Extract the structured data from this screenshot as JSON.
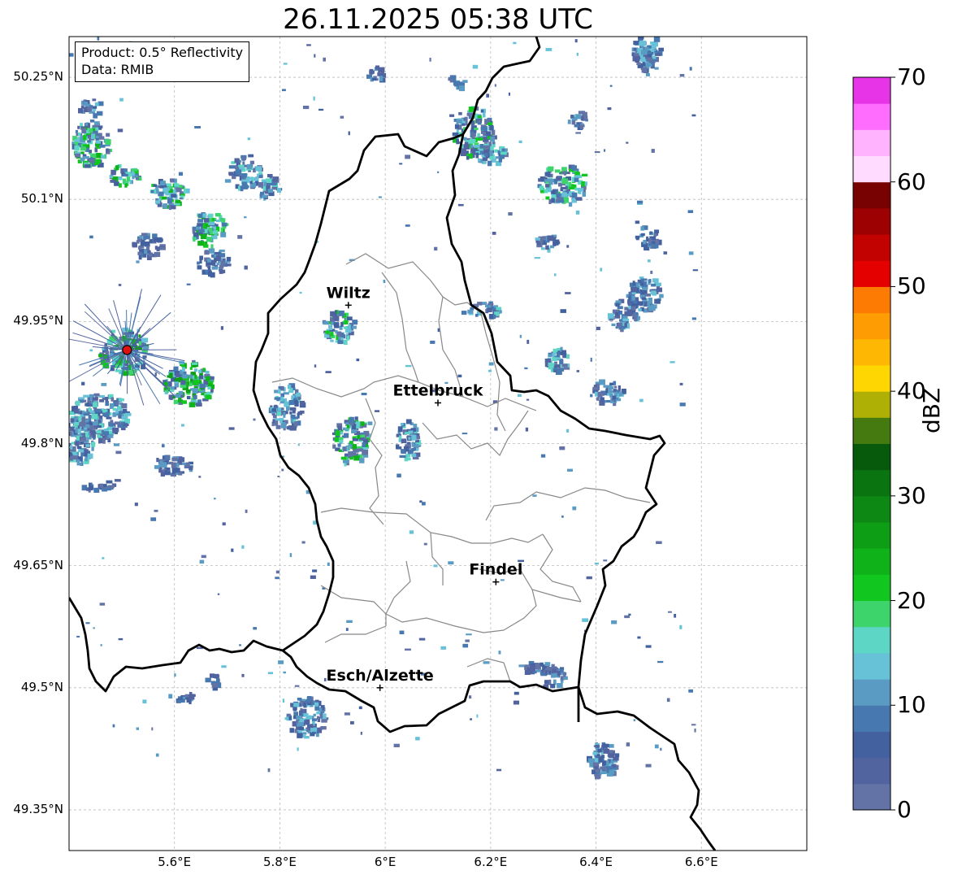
{
  "title": "26.11.2025 05:38 UTC",
  "legend": {
    "product": "Product: 0.5° Reflectivity",
    "source": "Data: RMIB"
  },
  "axes": {
    "lat_labels": [
      "50.25°N",
      "50.1°N",
      "49.95°N",
      "49.8°N",
      "49.65°N",
      "49.5°N",
      "49.35°N"
    ],
    "lat_values": [
      50.25,
      50.1,
      49.95,
      49.8,
      49.65,
      49.5,
      49.35
    ],
    "lon_labels": [
      "5.6°E",
      "5.8°E",
      "6°E",
      "6.2°E",
      "6.4°E",
      "6.6°E"
    ],
    "lon_values": [
      5.6,
      5.8,
      6.0,
      6.2,
      6.4,
      6.6
    ],
    "lon_range": [
      5.4,
      6.8
    ],
    "lat_range": [
      49.3,
      50.3
    ],
    "grid": true
  },
  "cities": [
    {
      "name": "Wiltz",
      "lon": 5.93,
      "lat": 49.97
    },
    {
      "name": "Ettelbruck",
      "lon": 6.1,
      "lat": 49.85
    },
    {
      "name": "Findel",
      "lon": 6.21,
      "lat": 49.63
    },
    {
      "name": "Esch/Alzette",
      "lon": 5.99,
      "lat": 49.5
    }
  ],
  "radar_site": {
    "lon": 5.51,
    "lat": 49.915,
    "color": "#e01010"
  },
  "colorbar": {
    "label": "dBZ",
    "min": 0,
    "max": 70,
    "step": 2.5,
    "tick_labels": [
      "0",
      "10",
      "20",
      "30",
      "40",
      "50",
      "60",
      "70"
    ],
    "tick_values": [
      0,
      10,
      20,
      30,
      40,
      50,
      60,
      70
    ],
    "colors": [
      "#6373a6",
      "#52649f",
      "#43609f",
      "#4878b0",
      "#5a9bc3",
      "#67c2d7",
      "#5ed6c6",
      "#3ed46c",
      "#12c620",
      "#10b21a",
      "#0e9e16",
      "#0e8814",
      "#0a7410",
      "#075a0c",
      "#457a11",
      "#aeb005",
      "#fed702",
      "#feb803",
      "#fe9c03",
      "#fd7b02",
      "#e50000",
      "#c20101",
      "#9e0101",
      "#780101",
      "#ffdcff",
      "#ffb3ff",
      "#ff6dff",
      "#e634e6"
    ]
  }
}
